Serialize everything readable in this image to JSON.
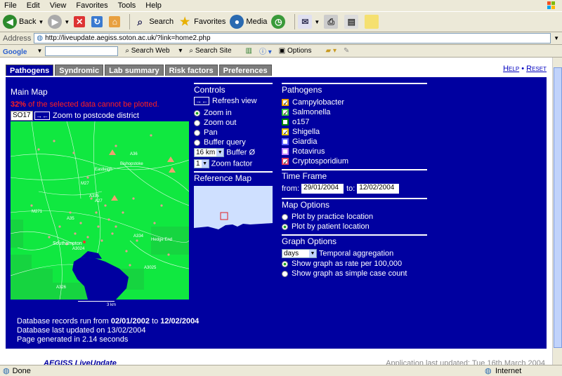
{
  "browser": {
    "menu": [
      "File",
      "Edit",
      "View",
      "Favorites",
      "Tools",
      "Help"
    ],
    "toolbar": {
      "back": "Back",
      "search": "Search",
      "favorites": "Favorites",
      "media": "Media"
    },
    "address_label": "Address",
    "url": "http://liveupdate.aegiss.soton.ac.uk/?link=home2.php",
    "google": {
      "logo": "Google",
      "search_web": "Search Web",
      "search_site": "Search Site",
      "options": "Options"
    },
    "status": {
      "left": "Done",
      "zone": "Internet"
    }
  },
  "tabs": [
    "Pathogens",
    "Syndromic",
    "Lab summary",
    "Risk factors",
    "Preferences"
  ],
  "toplinks": {
    "help": "Help",
    "sep": "•",
    "reset": "Reset"
  },
  "main_map": {
    "title": "Main Map",
    "warning_pct": "32%",
    "warning_text": " of the selected data cannot be plotted.",
    "postcode_value": "SO17",
    "zoom_postcode_label": "Zoom to postcode district",
    "labels": [
      "Eastleigh",
      "Bishopstoke",
      "Southampton",
      "Hedge End",
      "M27",
      "M271",
      "A35",
      "A335",
      "A27",
      "A3024",
      "A334",
      "A3025",
      "A326",
      "A36"
    ],
    "scale_label": "3 km",
    "scale_zero": "0"
  },
  "controls": {
    "title": "Controls",
    "refresh": "Refresh view",
    "options": [
      "Zoom in",
      "Zoom out",
      "Pan",
      "Buffer query"
    ],
    "selected": 0,
    "buffer_value": "16 km",
    "buffer_label": "Buffer Ø",
    "zoom_value": "1",
    "zoom_label": "Zoom factor"
  },
  "reference_map": {
    "title": "Reference Map"
  },
  "pathogens": {
    "title": "Pathogens",
    "items": [
      {
        "label": "Campylobacter",
        "color": "#e8a000",
        "checked": true
      },
      {
        "label": "Salmonella",
        "color": "#40c040",
        "checked": true
      },
      {
        "label": "o157",
        "color": "#008000",
        "checked": false
      },
      {
        "label": "Shigella",
        "color": "#e0c000",
        "checked": true
      },
      {
        "label": "Giardia",
        "color": "#6060ff",
        "checked": false
      },
      {
        "label": "Rotavirus",
        "color": "#c080ff",
        "checked": false
      },
      {
        "label": "Cryptosporidium",
        "color": "#e04060",
        "checked": true
      }
    ]
  },
  "time_frame": {
    "title": "Time Frame",
    "from_label": "from:",
    "from": "29/01/2004",
    "to_label": "to:",
    "to": "12/02/2004"
  },
  "map_options": {
    "title": "Map Options",
    "options": [
      "Plot by practice location",
      "Plot by patient location"
    ],
    "selected": 1
  },
  "graph_options": {
    "title": "Graph Options",
    "aggregation_value": "days",
    "aggregation_label": "Temporal aggregation",
    "options": [
      "Show graph as rate per 100,000",
      "Show graph as simple case count"
    ],
    "selected": 0
  },
  "footer": {
    "records_prefix": "Database records run from ",
    "records_from": "02/01/2002",
    "records_mid": " to ",
    "records_to": "12/02/2004",
    "updated": "Database last updated on 13/02/2004",
    "generated": "Page generated in 2.14 seconds"
  },
  "bottom": {
    "logo": "AEGISS LiveUpdate",
    "app_updated": "Application last updated: Tue 16th March 2004"
  }
}
